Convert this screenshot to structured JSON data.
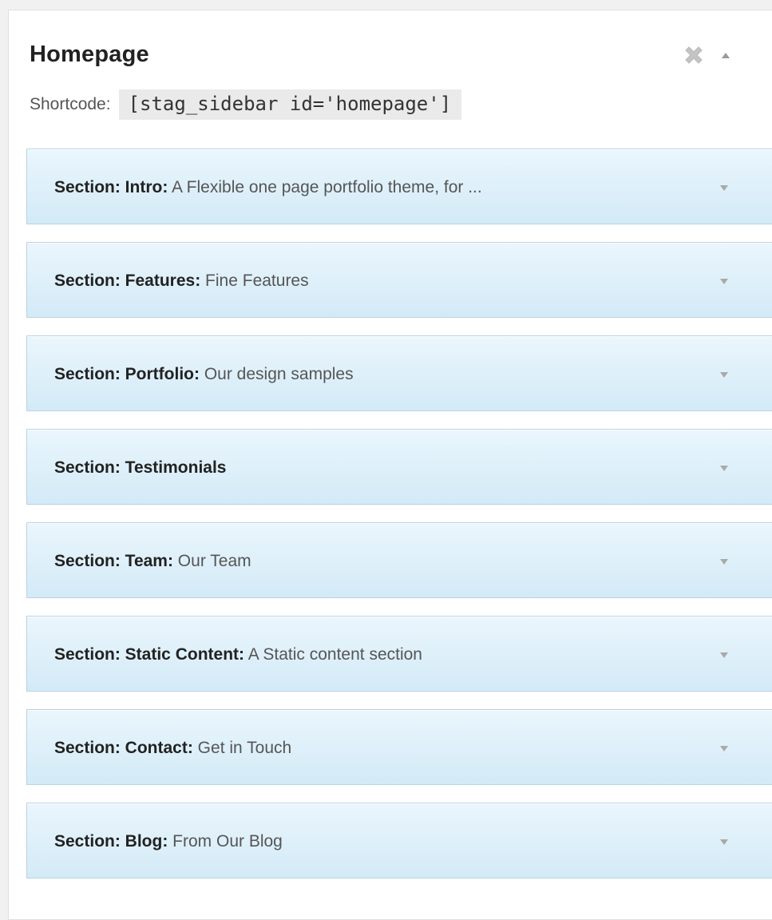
{
  "sidebar": {
    "title": "Homepage",
    "shortcode_label": "Shortcode:",
    "shortcode_value": "[stag_sidebar id='homepage']"
  },
  "icons": {
    "remove": "close-x-icon",
    "collapse": "triangle-up-icon",
    "widget_toggle": "triangle-down-icon"
  },
  "colors": {
    "widget_gradient_top": "#eaf6fc",
    "widget_gradient_bottom": "#d3eaf7",
    "widget_border": "#b7d3e3"
  },
  "widgets": [
    {
      "name": "Section: Intro",
      "desc": "A Flexible one page portfolio theme, for ..."
    },
    {
      "name": "Section: Features",
      "desc": "Fine Features"
    },
    {
      "name": "Section: Portfolio",
      "desc": "Our design samples"
    },
    {
      "name": "Section: Testimonials",
      "desc": ""
    },
    {
      "name": "Section: Team",
      "desc": "Our Team"
    },
    {
      "name": "Section: Static Content",
      "desc": "A Static content section"
    },
    {
      "name": "Section: Contact",
      "desc": "Get in Touch"
    },
    {
      "name": "Section: Blog",
      "desc": "From Our Blog"
    }
  ]
}
